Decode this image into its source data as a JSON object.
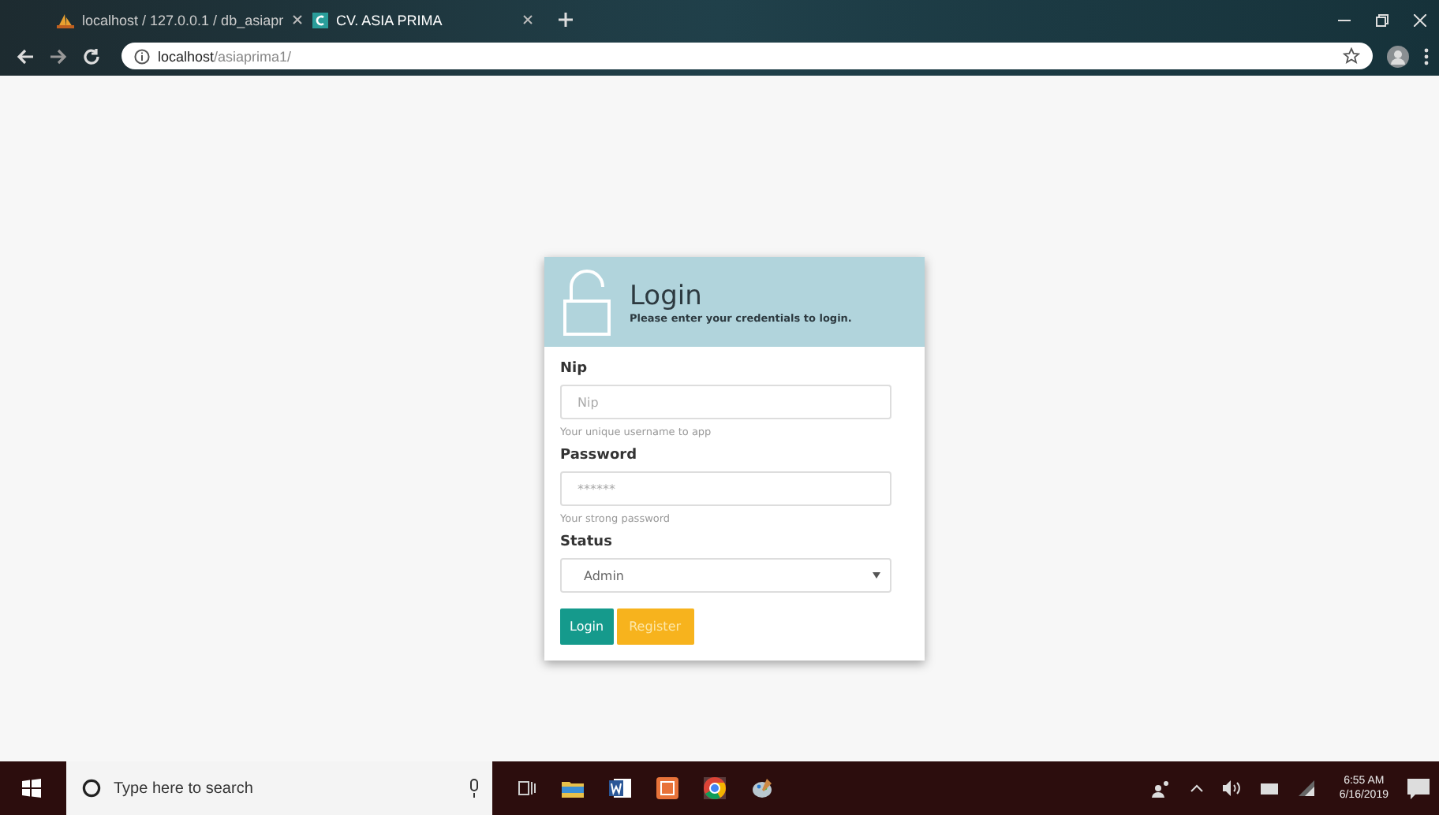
{
  "browser": {
    "tabs": [
      {
        "title": "localhost / 127.0.0.1 / db_asiapr",
        "selected": false
      },
      {
        "title": "CV. ASIA PRIMA",
        "selected": true
      }
    ],
    "address": {
      "host": "localhost",
      "path": "/asiaprima1/"
    }
  },
  "login": {
    "title": "Login",
    "subtitle": "Please enter your credentials to login.",
    "fields": [
      {
        "kind": "text",
        "label": "Nip",
        "placeholder": "Nip",
        "help": "Your unique username to app"
      },
      {
        "kind": "text",
        "label": "Password",
        "placeholder": "******",
        "help": "Your strong password"
      },
      {
        "kind": "select",
        "label": "Status",
        "value": "Admin"
      }
    ],
    "buttons": [
      {
        "label": "Login",
        "kind": "primary"
      },
      {
        "label": "Register",
        "kind": "warning"
      }
    ]
  },
  "taskbar": {
    "search_placeholder": "Type here to search",
    "time": "6:55 AM",
    "date": "6/16/2019"
  }
}
